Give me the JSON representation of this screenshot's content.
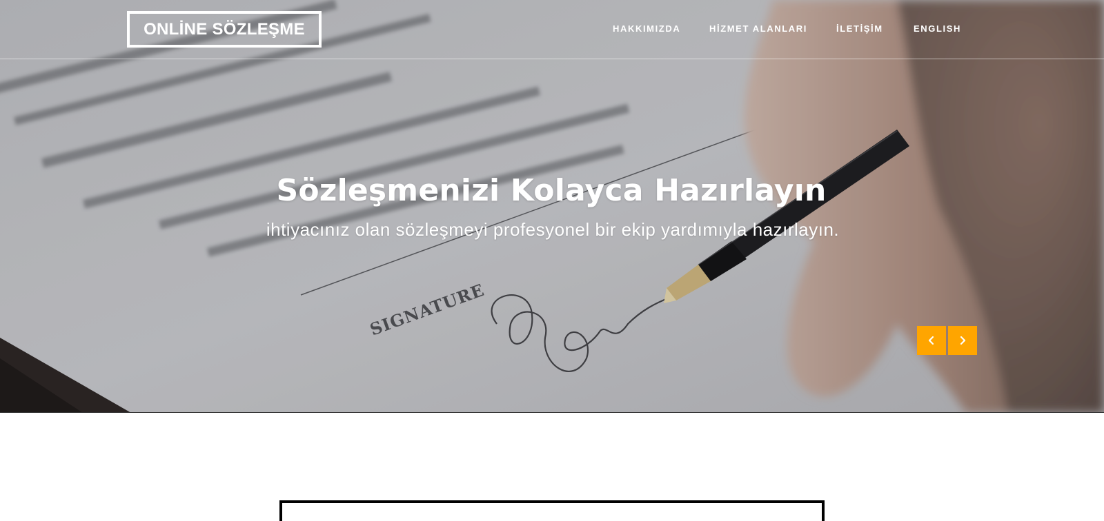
{
  "brand": {
    "name": "ONLİNE SÖZLEŞME"
  },
  "nav": {
    "items": [
      {
        "label": "HAKKIMIZDA"
      },
      {
        "label": "HİZMET ALANLARI"
      },
      {
        "label": "İLETİŞİM"
      },
      {
        "label": "ENGLISH"
      }
    ]
  },
  "hero": {
    "title": "Sözleşmenizi Kolayca Hazırlayın",
    "subtitle": "ihtiyacınız olan sözleşmeyi profesyonel bir ekip yardımıyla hazırlayın.",
    "photo_text": "SIGNATURE",
    "controls": {
      "prev_icon": "chevron-left-icon",
      "next_icon": "chevron-right-icon"
    }
  },
  "colors": {
    "accent": "#ffa500",
    "nav_text": "#ffffff",
    "content_border": "#000000"
  }
}
